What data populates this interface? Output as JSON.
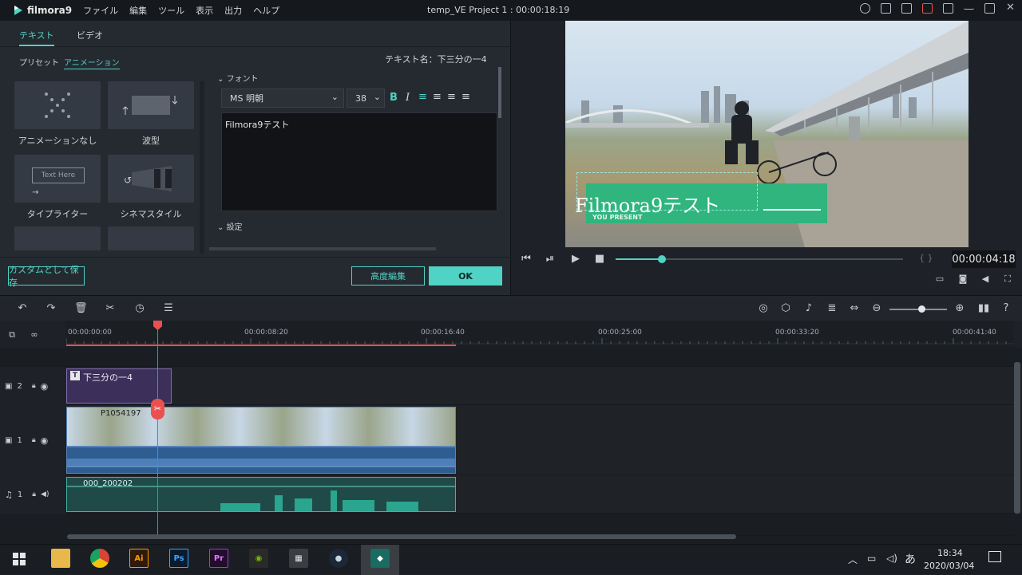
{
  "titlebar": {
    "app_name": "filmora9",
    "menu": [
      "ファイル",
      "編集",
      "ツール",
      "表示",
      "出力",
      "ヘルプ"
    ],
    "project_title": "temp_VE Project 1 : 00:00:18:19"
  },
  "left_panel": {
    "tabs": [
      "テキスト",
      "ビデオ"
    ],
    "subtabs": [
      "プリセット",
      "アニメーション"
    ],
    "text_name_label": "テキスト名：下三分の一4",
    "animations": [
      {
        "label": "アニメーションなし",
        "icon": "dots-x-icon"
      },
      {
        "label": "波型",
        "icon": "wave-icon"
      },
      {
        "label": "タイプライター",
        "icon": "typewriter-icon",
        "thumb_text": "Text Here"
      },
      {
        "label": "シネマスタイル",
        "icon": "cinema-icon"
      }
    ],
    "font_section": "フォント",
    "font_name": "MS 明朝",
    "font_size": "38",
    "text_content": "Filmora9テスト",
    "settings_section": "設定",
    "save_custom": "カスタムとして保存",
    "advanced_edit": "高度編集",
    "ok": "OK"
  },
  "preview": {
    "overlay_title": "Filmora9テスト",
    "overlay_subtitle": "YOU PRESENT",
    "timecode": "00:00:04:18",
    "brackets": "{   }",
    "progress_pct": 16
  },
  "timeline": {
    "ruler_labels": [
      "00:00:00:00",
      "00:00:08:20",
      "00:00:16:40",
      "00:00:25:00",
      "00:00:33:20",
      "00:00:41:40"
    ],
    "tracks": [
      {
        "id": "2",
        "type": "video"
      },
      {
        "id": "1",
        "type": "video"
      },
      {
        "id": "1",
        "type": "audio"
      }
    ],
    "title_clip": "下三分の一4",
    "video_clip": "P1054197",
    "audio_clip": "000_200202"
  },
  "taskbar": {
    "time": "18:34",
    "date": "2020/03/04",
    "ime": "あ",
    "apps": [
      "file-explorer",
      "chrome",
      "illustrator",
      "photoshop",
      "premiere",
      "nvidia",
      "calculator",
      "steam",
      "filmora"
    ],
    "app_labels": {
      "illustrator": "Ai",
      "photoshop": "Ps",
      "premiere": "Pr"
    }
  },
  "colors": {
    "accent": "#4fd3c4",
    "playhead": "#e9504f",
    "title_clip": "#3c2f5a",
    "audio_wave": "#2aa58f",
    "overlay_green": "#2fb57d"
  }
}
